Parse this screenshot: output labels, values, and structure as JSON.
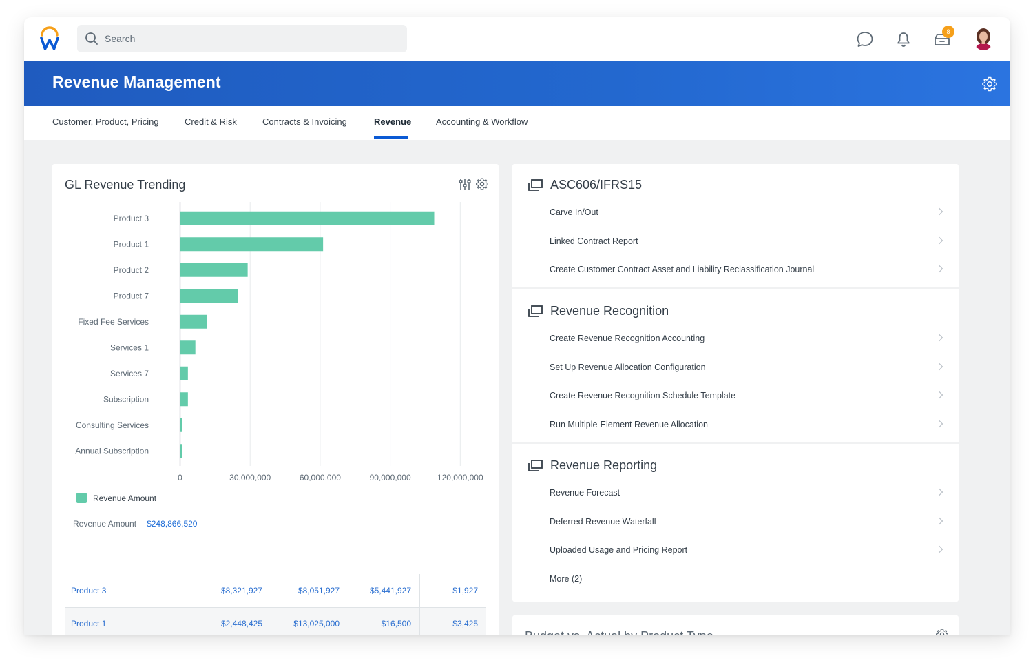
{
  "app": {
    "search_placeholder": "Search",
    "notification_badge": "8",
    "colors": {
      "brand_blue": "#2368cf",
      "logo_orange": "#f6a01a",
      "bar": "#63cbaa",
      "link": "#1c6bd6"
    }
  },
  "header": {
    "title": "Revenue Management"
  },
  "tabs": [
    {
      "label": "Customer, Product, Pricing",
      "active": false
    },
    {
      "label": "Credit & Risk",
      "active": false
    },
    {
      "label": "Contracts & Invoicing",
      "active": false
    },
    {
      "label": "Revenue",
      "active": true
    },
    {
      "label": "Accounting & Workflow",
      "active": false
    }
  ],
  "chart_card": {
    "title": "GL Revenue Trending",
    "summary_label": "Revenue Amount",
    "summary_value": "$248,866,520",
    "table": [
      {
        "name": "Product 3",
        "cells": [
          "$8,321,927",
          "$8,051,927",
          "$5,441,927",
          "$1,927"
        ]
      },
      {
        "name": "Product 1",
        "cells": [
          "$2,448,425",
          "$13,025,000",
          "$16,500",
          "$3,425"
        ]
      }
    ]
  },
  "chart_data": {
    "type": "bar",
    "orientation": "horizontal",
    "title": "GL Revenue Trending",
    "categories": [
      "Product 3",
      "Product 1",
      "Product 2",
      "Product 7",
      "Fixed Fee Services",
      "Services 1",
      "Services 7",
      "Subscription",
      "Consulting Services",
      "Annual Subscription"
    ],
    "series": [
      {
        "name": "Revenue Amount",
        "values": [
          108700000,
          61100000,
          28800000,
          24500000,
          11500000,
          6400000,
          3200000,
          3200000,
          800000,
          800000
        ]
      }
    ],
    "xlabel": "",
    "ylabel": "",
    "xlim": [
      0,
      130000000
    ],
    "xticks": [
      0,
      30000000,
      60000000,
      90000000,
      120000000
    ],
    "xtick_labels": [
      "0",
      "30,000,000",
      "60,000,000",
      "90,000,000",
      "120,000,000"
    ],
    "grid": true,
    "legend": "bottom-left"
  },
  "links_card": {
    "sections": [
      {
        "title": "ASC606/IFRS15",
        "items": [
          "Carve In/Out",
          "Linked Contract Report",
          "Create Customer Contract Asset and Liability Reclassification Journal"
        ]
      },
      {
        "title": "Revenue Recognition",
        "items": [
          "Create Revenue Recognition Accounting",
          "Set Up Revenue Allocation Configuration",
          "Create Revenue Recognition Schedule Template",
          "Run Multiple-Element Revenue Allocation"
        ]
      },
      {
        "title": "Revenue Reporting",
        "items": [
          "Revenue Forecast",
          "Deferred Revenue Waterfall",
          "Uploaded Usage and Pricing Report"
        ],
        "more": "More (2)"
      }
    ]
  },
  "budget_card": {
    "title": "Budget vs. Actual by Product Type"
  }
}
